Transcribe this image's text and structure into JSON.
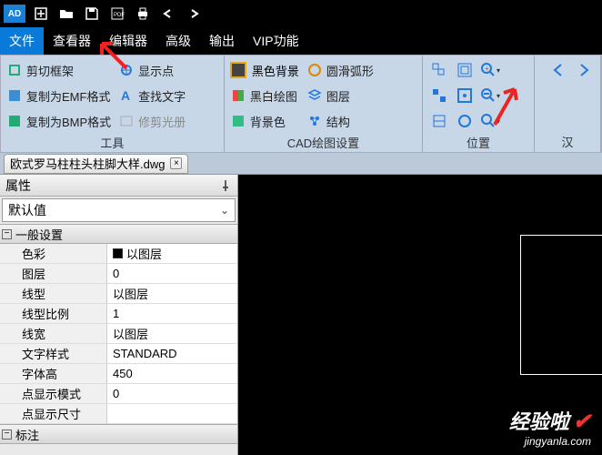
{
  "logo": "AD",
  "menu": {
    "file": "文件",
    "viewer": "查看器",
    "editor": "编辑器",
    "advanced": "高级",
    "output": "输出",
    "vip": "VIP功能"
  },
  "ribbon": {
    "group1": {
      "title": "工具",
      "crop": "剪切框架",
      "emf": "复制为EMF格式",
      "bmp": "复制为BMP格式",
      "showpt": "显示点",
      "findtext": "查找文字",
      "editalbum": "修剪光册"
    },
    "group2": {
      "title": "CAD绘图设置",
      "blackbg": "黑色背景",
      "smootharc": "圆滑弧形",
      "bwdraw": "黑白绘图",
      "layer": "图层",
      "bgcolor": "背景色",
      "struct": "结构"
    },
    "group3_title": "位置",
    "group4_title": "汉"
  },
  "doc_tab": "欧式罗马柱柱头柱脚大样.dwg",
  "props_panel_title": "属性",
  "default_value_label": "默认值",
  "sections": {
    "general": "一般设置",
    "annotate": "标注"
  },
  "props": [
    {
      "label": "色彩",
      "value": "以图层",
      "swatch": true
    },
    {
      "label": "图层",
      "value": "0"
    },
    {
      "label": "线型",
      "value": "以图层"
    },
    {
      "label": "线型比例",
      "value": "1"
    },
    {
      "label": "线宽",
      "value": "以图层"
    },
    {
      "label": "文字样式",
      "value": "STANDARD"
    },
    {
      "label": "字体高",
      "value": "450"
    },
    {
      "label": "点显示模式",
      "value": "0"
    },
    {
      "label": "点显示尺寸",
      "value": ""
    }
  ],
  "watermark": {
    "line1": "经验啦",
    "line2": "jingyanla.com"
  }
}
